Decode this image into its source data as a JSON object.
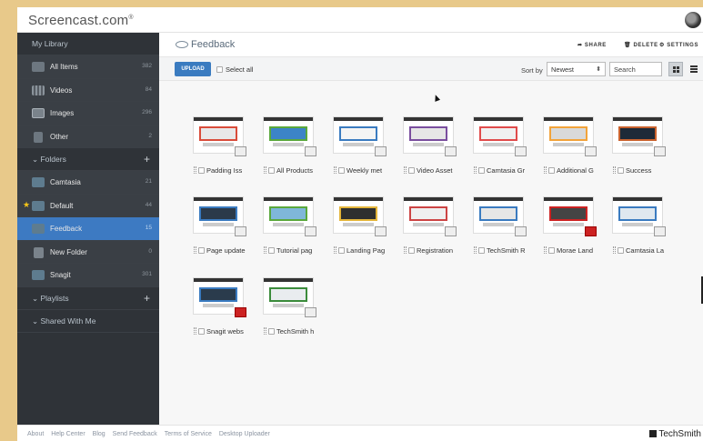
{
  "brand": {
    "logo": "Screencast.com",
    "trademark": "®"
  },
  "sidebar": {
    "library_header": "My Library",
    "library_items": [
      {
        "label": "All Items",
        "count": "382",
        "icon": "all-items-icon"
      },
      {
        "label": "Videos",
        "count": "84",
        "icon": "film-icon"
      },
      {
        "label": "Images",
        "count": "296",
        "icon": "image-icon"
      },
      {
        "label": "Other",
        "count": "2",
        "icon": "document-icon"
      }
    ],
    "folders_header": "Folders",
    "folders": [
      {
        "label": "Camtasia",
        "count": "21"
      },
      {
        "label": "Default",
        "count": "44"
      },
      {
        "label": "Feedback",
        "count": "15"
      },
      {
        "label": "New Folder",
        "count": "0"
      },
      {
        "label": "Snagit",
        "count": "301"
      }
    ],
    "playlists_header": "Playlists",
    "shared_header": "Shared With Me"
  },
  "header": {
    "title": "Feedback",
    "share": "SHARE",
    "delete": "DELETE",
    "settings": "SETTINGS"
  },
  "toolbar": {
    "upload": "UPLOAD",
    "select_all": "Select all",
    "sort_label": "Sort by",
    "sort_value": "Newest",
    "search_value": "Search"
  },
  "tiles": [
    {
      "label": "Padding Iss"
    },
    {
      "label": "All Products"
    },
    {
      "label": "Weekly met"
    },
    {
      "label": "Video Asset"
    },
    {
      "label": "Camtasia Gr"
    },
    {
      "label": "Additional G"
    },
    {
      "label": "Success"
    },
    {
      "label": "Page update"
    },
    {
      "label": "Tutorial pag"
    },
    {
      "label": "Landing Pag"
    },
    {
      "label": "Registration"
    },
    {
      "label": "TechSmith R"
    },
    {
      "label": "Morae Land"
    },
    {
      "label": "Camtasia La"
    },
    {
      "label": "Snagit webs"
    },
    {
      "label": "TechSmith h"
    }
  ],
  "footer": {
    "links": [
      "About",
      "Help Center",
      "Blog",
      "Send Feedback",
      "Terms of Service",
      "Desktop Uploader"
    ],
    "brand": "TechSmith"
  },
  "colors": {
    "accent": "#3a7bc0",
    "sidebar": "#2f3338",
    "active": "#3d7ac2",
    "star": "#f5c518"
  }
}
